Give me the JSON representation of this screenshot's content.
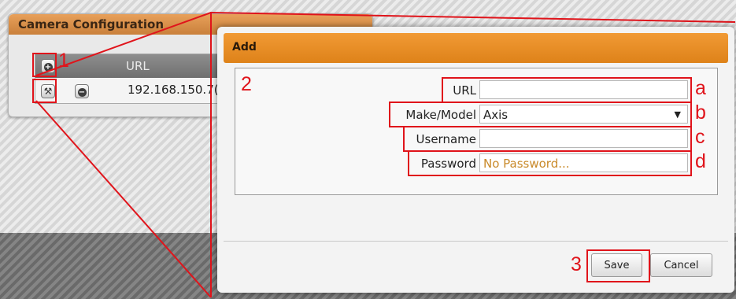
{
  "background_panel": {
    "title": "Camera Configuration",
    "table": {
      "url_header": "URL",
      "rows": [
        {
          "url": "192.168.150.7("
        }
      ]
    }
  },
  "dialog": {
    "title": "Add",
    "fields": {
      "url": {
        "label": "URL",
        "value": ""
      },
      "make_model": {
        "label": "Make/Model",
        "value": "Axis"
      },
      "username": {
        "label": "Username",
        "value": ""
      },
      "password": {
        "label": "Password",
        "placeholder": "No Password..."
      }
    },
    "buttons": {
      "save": "Save",
      "cancel": "Cancel"
    }
  },
  "annotations": {
    "n1": "1",
    "n2": "2",
    "n3": "3",
    "a": "a",
    "b": "b",
    "c": "c",
    "d": "d"
  },
  "colors": {
    "annotation_red": "#e0141b",
    "accent_orange": "#e88a1f"
  }
}
